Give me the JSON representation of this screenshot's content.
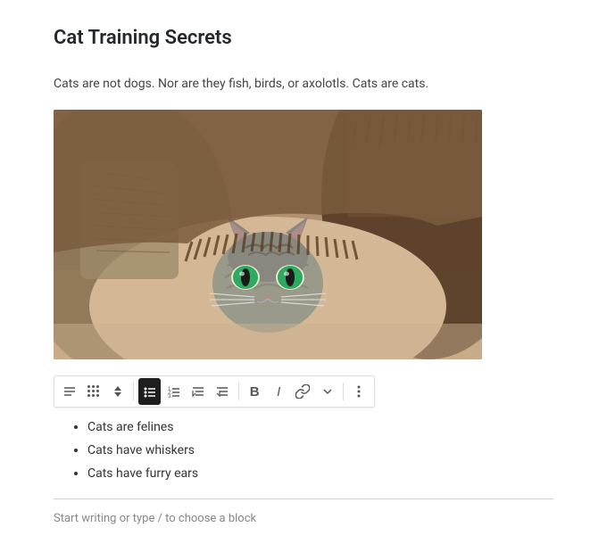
{
  "page": {
    "title": "Cat Training Secrets",
    "intro": "Cats are not dogs. Nor are they fish, birds, or axolotls. Cats are cats.",
    "add_block_hint": "Start writing or type / to choose a block"
  },
  "list": {
    "items": [
      "Cats are felines",
      "Cats have whiskers",
      "Cats have furry ears"
    ]
  },
  "toolbar": {
    "align_label": "≡",
    "grid_label": "⠿",
    "arrows_label": "⇅",
    "list_label": "≡",
    "ordered_label": "≡",
    "indent_label": "→",
    "outdent_label": "←",
    "bold_label": "B",
    "italic_label": "I",
    "link_label": "🔗",
    "more_label": "⋮"
  }
}
